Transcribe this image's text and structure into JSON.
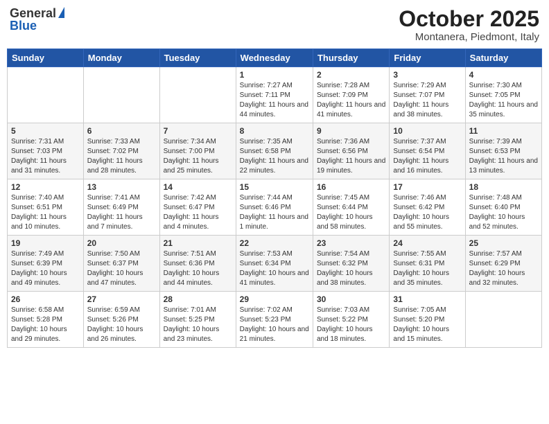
{
  "logo": {
    "general": "General",
    "blue": "Blue"
  },
  "title": {
    "month_year": "October 2025",
    "location": "Montanera, Piedmont, Italy"
  },
  "weekdays": [
    "Sunday",
    "Monday",
    "Tuesday",
    "Wednesday",
    "Thursday",
    "Friday",
    "Saturday"
  ],
  "weeks": [
    [
      {
        "day": "",
        "sunrise": "",
        "sunset": "",
        "daylight": ""
      },
      {
        "day": "",
        "sunrise": "",
        "sunset": "",
        "daylight": ""
      },
      {
        "day": "",
        "sunrise": "",
        "sunset": "",
        "daylight": ""
      },
      {
        "day": "1",
        "sunrise": "Sunrise: 7:27 AM",
        "sunset": "Sunset: 7:11 PM",
        "daylight": "Daylight: 11 hours and 44 minutes."
      },
      {
        "day": "2",
        "sunrise": "Sunrise: 7:28 AM",
        "sunset": "Sunset: 7:09 PM",
        "daylight": "Daylight: 11 hours and 41 minutes."
      },
      {
        "day": "3",
        "sunrise": "Sunrise: 7:29 AM",
        "sunset": "Sunset: 7:07 PM",
        "daylight": "Daylight: 11 hours and 38 minutes."
      },
      {
        "day": "4",
        "sunrise": "Sunrise: 7:30 AM",
        "sunset": "Sunset: 7:05 PM",
        "daylight": "Daylight: 11 hours and 35 minutes."
      }
    ],
    [
      {
        "day": "5",
        "sunrise": "Sunrise: 7:31 AM",
        "sunset": "Sunset: 7:03 PM",
        "daylight": "Daylight: 11 hours and 31 minutes."
      },
      {
        "day": "6",
        "sunrise": "Sunrise: 7:33 AM",
        "sunset": "Sunset: 7:02 PM",
        "daylight": "Daylight: 11 hours and 28 minutes."
      },
      {
        "day": "7",
        "sunrise": "Sunrise: 7:34 AM",
        "sunset": "Sunset: 7:00 PM",
        "daylight": "Daylight: 11 hours and 25 minutes."
      },
      {
        "day": "8",
        "sunrise": "Sunrise: 7:35 AM",
        "sunset": "Sunset: 6:58 PM",
        "daylight": "Daylight: 11 hours and 22 minutes."
      },
      {
        "day": "9",
        "sunrise": "Sunrise: 7:36 AM",
        "sunset": "Sunset: 6:56 PM",
        "daylight": "Daylight: 11 hours and 19 minutes."
      },
      {
        "day": "10",
        "sunrise": "Sunrise: 7:37 AM",
        "sunset": "Sunset: 6:54 PM",
        "daylight": "Daylight: 11 hours and 16 minutes."
      },
      {
        "day": "11",
        "sunrise": "Sunrise: 7:39 AM",
        "sunset": "Sunset: 6:53 PM",
        "daylight": "Daylight: 11 hours and 13 minutes."
      }
    ],
    [
      {
        "day": "12",
        "sunrise": "Sunrise: 7:40 AM",
        "sunset": "Sunset: 6:51 PM",
        "daylight": "Daylight: 11 hours and 10 minutes."
      },
      {
        "day": "13",
        "sunrise": "Sunrise: 7:41 AM",
        "sunset": "Sunset: 6:49 PM",
        "daylight": "Daylight: 11 hours and 7 minutes."
      },
      {
        "day": "14",
        "sunrise": "Sunrise: 7:42 AM",
        "sunset": "Sunset: 6:47 PM",
        "daylight": "Daylight: 11 hours and 4 minutes."
      },
      {
        "day": "15",
        "sunrise": "Sunrise: 7:44 AM",
        "sunset": "Sunset: 6:46 PM",
        "daylight": "Daylight: 11 hours and 1 minute."
      },
      {
        "day": "16",
        "sunrise": "Sunrise: 7:45 AM",
        "sunset": "Sunset: 6:44 PM",
        "daylight": "Daylight: 10 hours and 58 minutes."
      },
      {
        "day": "17",
        "sunrise": "Sunrise: 7:46 AM",
        "sunset": "Sunset: 6:42 PM",
        "daylight": "Daylight: 10 hours and 55 minutes."
      },
      {
        "day": "18",
        "sunrise": "Sunrise: 7:48 AM",
        "sunset": "Sunset: 6:40 PM",
        "daylight": "Daylight: 10 hours and 52 minutes."
      }
    ],
    [
      {
        "day": "19",
        "sunrise": "Sunrise: 7:49 AM",
        "sunset": "Sunset: 6:39 PM",
        "daylight": "Daylight: 10 hours and 49 minutes."
      },
      {
        "day": "20",
        "sunrise": "Sunrise: 7:50 AM",
        "sunset": "Sunset: 6:37 PM",
        "daylight": "Daylight: 10 hours and 47 minutes."
      },
      {
        "day": "21",
        "sunrise": "Sunrise: 7:51 AM",
        "sunset": "Sunset: 6:36 PM",
        "daylight": "Daylight: 10 hours and 44 minutes."
      },
      {
        "day": "22",
        "sunrise": "Sunrise: 7:53 AM",
        "sunset": "Sunset: 6:34 PM",
        "daylight": "Daylight: 10 hours and 41 minutes."
      },
      {
        "day": "23",
        "sunrise": "Sunrise: 7:54 AM",
        "sunset": "Sunset: 6:32 PM",
        "daylight": "Daylight: 10 hours and 38 minutes."
      },
      {
        "day": "24",
        "sunrise": "Sunrise: 7:55 AM",
        "sunset": "Sunset: 6:31 PM",
        "daylight": "Daylight: 10 hours and 35 minutes."
      },
      {
        "day": "25",
        "sunrise": "Sunrise: 7:57 AM",
        "sunset": "Sunset: 6:29 PM",
        "daylight": "Daylight: 10 hours and 32 minutes."
      }
    ],
    [
      {
        "day": "26",
        "sunrise": "Sunrise: 6:58 AM",
        "sunset": "Sunset: 5:28 PM",
        "daylight": "Daylight: 10 hours and 29 minutes."
      },
      {
        "day": "27",
        "sunrise": "Sunrise: 6:59 AM",
        "sunset": "Sunset: 5:26 PM",
        "daylight": "Daylight: 10 hours and 26 minutes."
      },
      {
        "day": "28",
        "sunrise": "Sunrise: 7:01 AM",
        "sunset": "Sunset: 5:25 PM",
        "daylight": "Daylight: 10 hours and 23 minutes."
      },
      {
        "day": "29",
        "sunrise": "Sunrise: 7:02 AM",
        "sunset": "Sunset: 5:23 PM",
        "daylight": "Daylight: 10 hours and 21 minutes."
      },
      {
        "day": "30",
        "sunrise": "Sunrise: 7:03 AM",
        "sunset": "Sunset: 5:22 PM",
        "daylight": "Daylight: 10 hours and 18 minutes."
      },
      {
        "day": "31",
        "sunrise": "Sunrise: 7:05 AM",
        "sunset": "Sunset: 5:20 PM",
        "daylight": "Daylight: 10 hours and 15 minutes."
      },
      {
        "day": "",
        "sunrise": "",
        "sunset": "",
        "daylight": ""
      }
    ]
  ]
}
